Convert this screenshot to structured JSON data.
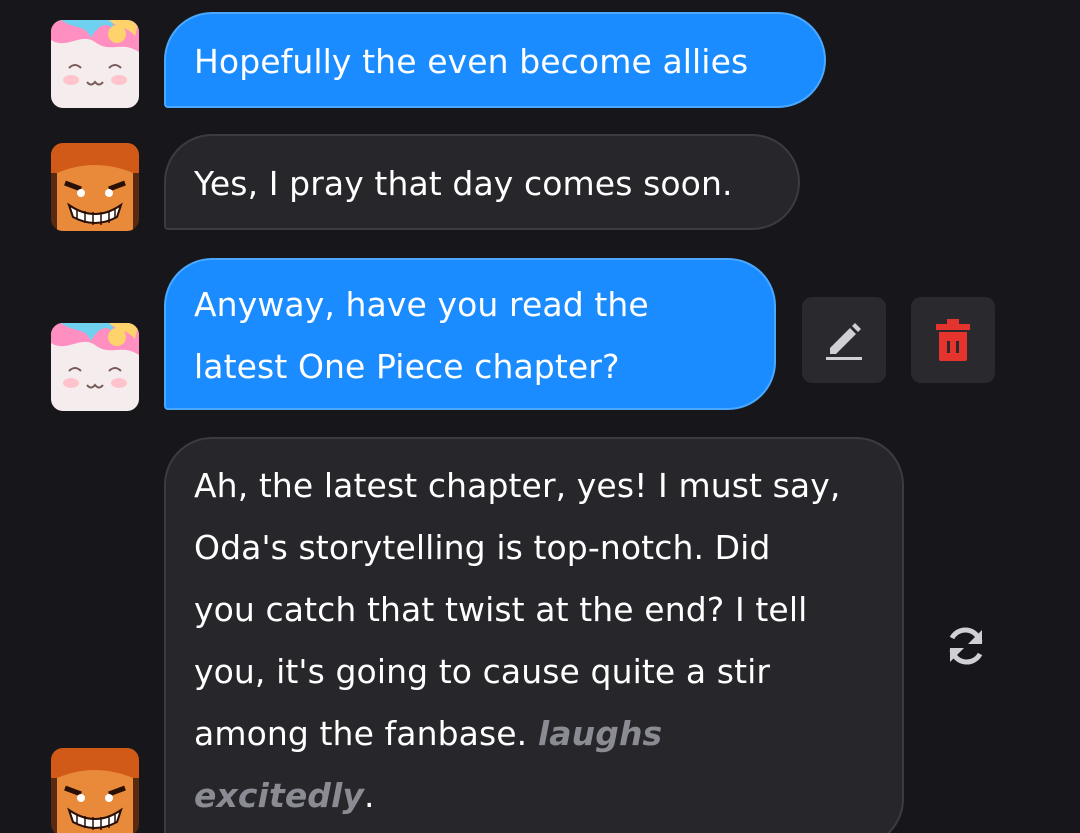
{
  "messages": [
    {
      "role": "user",
      "text": "Hopefully the even become allies"
    },
    {
      "role": "bot",
      "text": "Yes, I pray that day comes soon."
    },
    {
      "role": "user",
      "lines": [
        "Anyway, have you read the",
        "latest One Piece chapter?"
      ]
    },
    {
      "role": "bot",
      "lines": [
        "Ah, the latest chapter, yes! I must say,",
        "Oda's storytelling is top-notch. Did",
        "you catch that twist at the end? I tell",
        "you, it's going to cause quite a stir"
      ],
      "line5_plain": "among the fanbase. ",
      "line5_action": "laughs",
      "line6_action": "excitedly",
      "line6_plain": "."
    }
  ],
  "icons": {
    "edit": "pencil-icon",
    "delete": "trash-icon",
    "regenerate": "refresh-icon"
  },
  "colors": {
    "background": "#17171b",
    "user_bubble": "#1a8cff",
    "bot_bubble": "#26262b",
    "delete_red": "#e5332d",
    "action_text": "#8b8b93"
  }
}
